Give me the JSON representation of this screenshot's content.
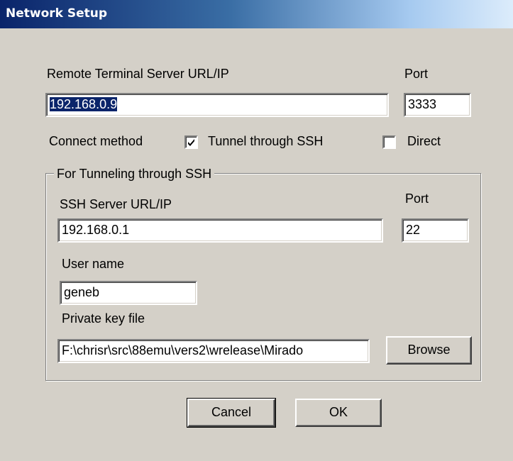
{
  "window": {
    "title": "Network Setup"
  },
  "remote": {
    "label": "Remote Terminal Server URL/IP",
    "value": "192.168.0.9",
    "port_label": "Port",
    "port_value": "3333"
  },
  "connect": {
    "label": "Connect method",
    "tunnel_label": "Tunnel through SSH",
    "tunnel_checked": true,
    "direct_label": "Direct",
    "direct_checked": false
  },
  "ssh": {
    "group_title": "For Tunneling through SSH",
    "server_label": "SSH Server URL/IP",
    "server_value": "192.168.0.1",
    "port_label": "Port",
    "port_value": "22",
    "user_label": "User name",
    "user_value": "geneb",
    "key_label": "Private key file",
    "key_value": "F:\\chrisr\\src\\88emu\\vers2\\wrelease\\Mirado",
    "browse_label": "Browse"
  },
  "buttons": {
    "cancel": "Cancel",
    "ok": "OK"
  }
}
